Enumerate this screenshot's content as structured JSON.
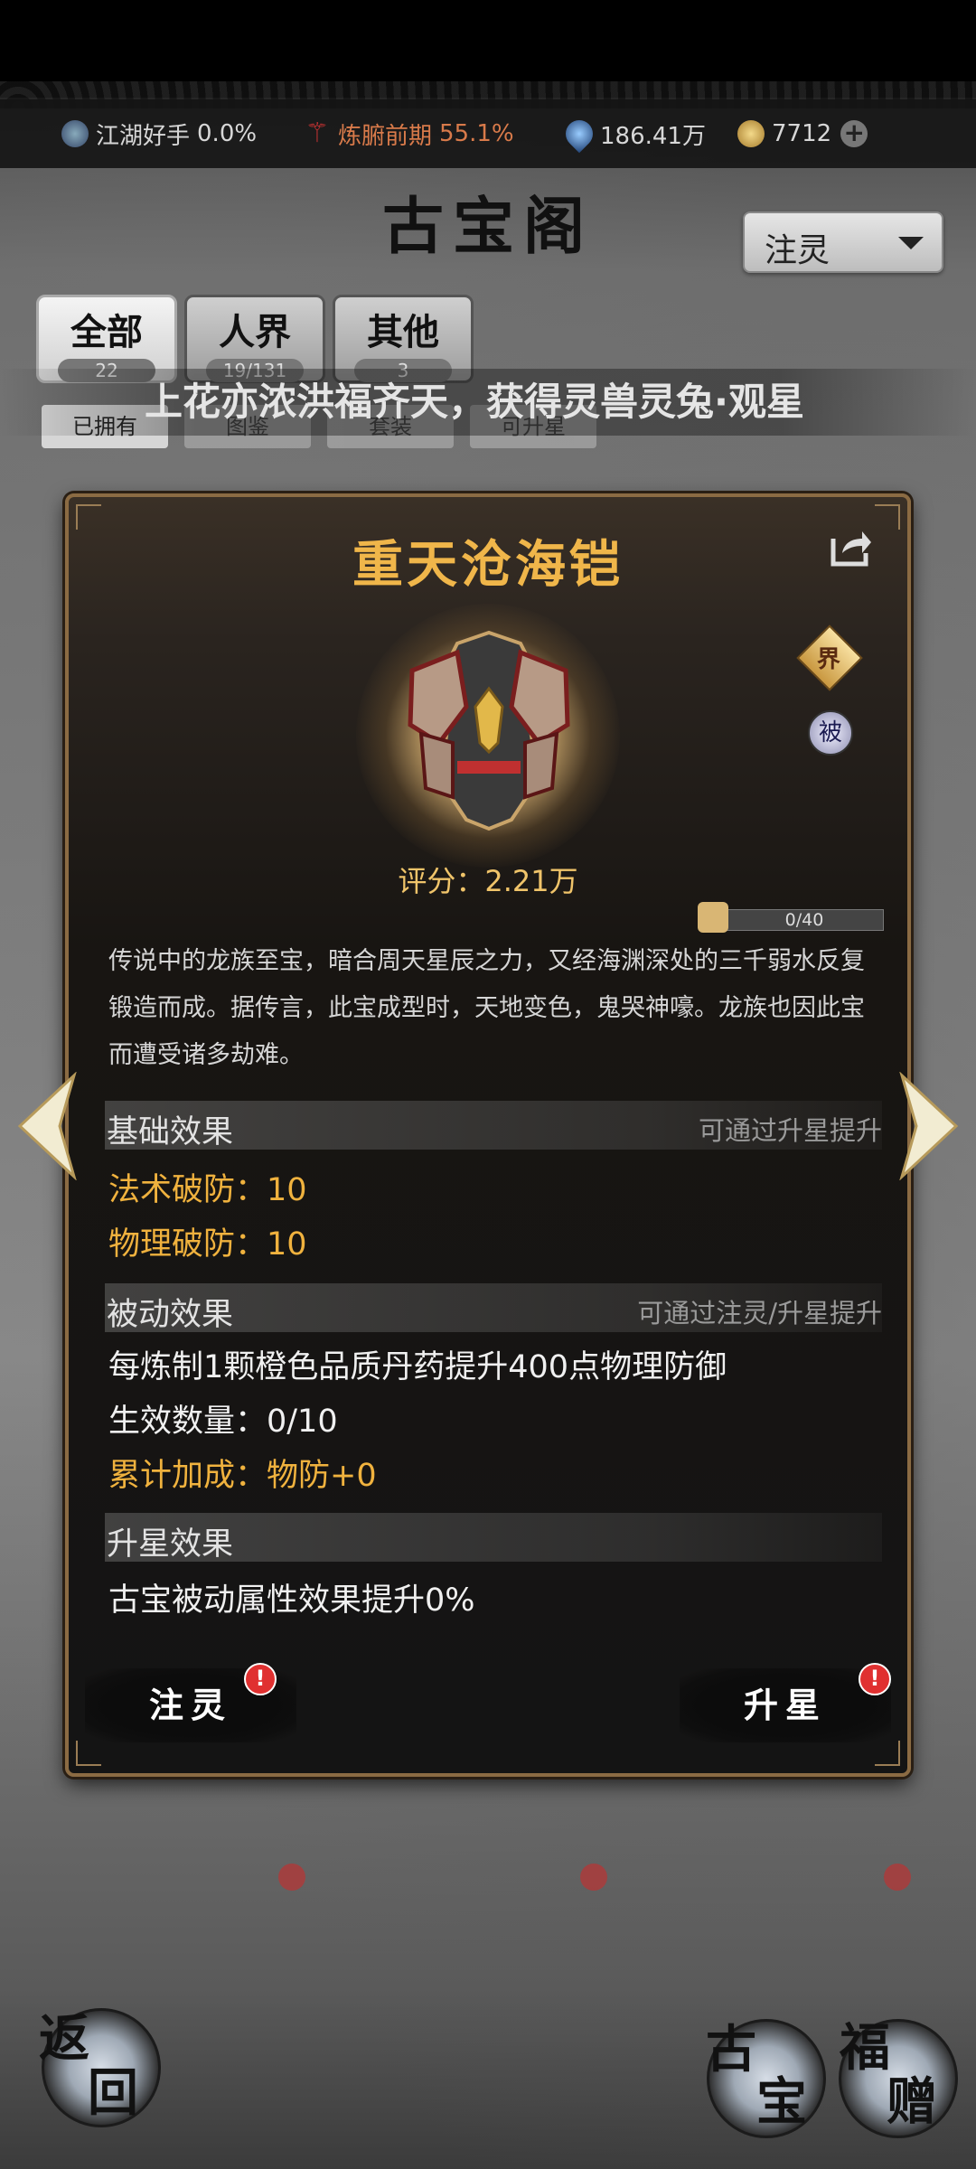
{
  "resources": {
    "cultivation": {
      "label": "江湖好手",
      "value": "0.0%"
    },
    "realm": {
      "label": "炼腑前期",
      "value": "55.1%"
    },
    "spirit": "186.41万",
    "coins": "7712"
  },
  "page_title": "古宝阁",
  "filter_select": {
    "value": "注灵"
  },
  "tabs": [
    {
      "label": "全部",
      "count": "22"
    },
    {
      "label": "人界",
      "count": "19/131"
    },
    {
      "label": "其他",
      "count": "3"
    }
  ],
  "marquee": "上花亦浓洪福齐天，获得灵兽灵兔·观星",
  "subtabs": [
    "已拥有",
    "图鉴",
    "套装",
    "可升星"
  ],
  "treasure": {
    "name": "重天沧海铠",
    "badge_realm": "界",
    "badge_passive": "被",
    "score_label": "评分：",
    "score_value": "2.21万",
    "fragments": "0/40",
    "description": "传说中的龙族至宝，暗合周天星辰之力，又经海渊深处的三千弱水反复锻造而成。据传言，此宝成型时，天地变色，鬼哭神嚎。龙族也因此宝而遭受诸多劫难。"
  },
  "base_effect": {
    "title": "基础效果",
    "hint": "可通过升星提升",
    "lines": [
      "法术破防：10",
      "物理破防：10"
    ]
  },
  "passive_effect": {
    "title": "被动效果",
    "hint": "可通过注灵/升星提升",
    "line1": "每炼制1颗橙色品质丹药提升400点物理防御",
    "line2": "生效数量：0/10",
    "line3": "累计加成：物防+0"
  },
  "star_effect": {
    "title": "升星效果",
    "line1": "古宝被动属性效果提升0%"
  },
  "buttons": {
    "infuse": "注灵",
    "upgrade": "升星",
    "alert": "!"
  },
  "bottom": {
    "back": [
      "返",
      "回"
    ],
    "treasure": [
      "古",
      "宝"
    ],
    "gift": [
      "福",
      "赠"
    ]
  },
  "colors": {
    "gold": "#f0b23e",
    "title_gold": "#f0b64a",
    "frame": "#8b6b43",
    "alert_red": "#e03030"
  }
}
